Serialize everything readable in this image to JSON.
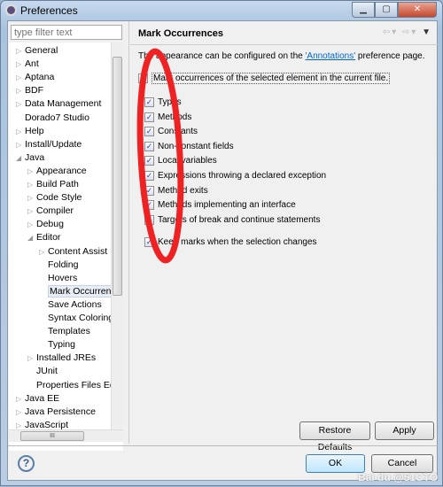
{
  "window": {
    "title": "Preferences",
    "controls": [
      "minimize",
      "maximize",
      "close"
    ]
  },
  "filter": {
    "placeholder": "type filter text"
  },
  "tree": [
    {
      "label": "General",
      "level": 0,
      "arrow": "collapsed"
    },
    {
      "label": "Ant",
      "level": 0,
      "arrow": "collapsed"
    },
    {
      "label": "Aptana",
      "level": 0,
      "arrow": "collapsed"
    },
    {
      "label": "BDF",
      "level": 0,
      "arrow": "collapsed"
    },
    {
      "label": "Data Management",
      "level": 0,
      "arrow": "collapsed"
    },
    {
      "label": "Dorado7 Studio",
      "level": 0,
      "arrow": "none"
    },
    {
      "label": "Help",
      "level": 0,
      "arrow": "collapsed"
    },
    {
      "label": "Install/Update",
      "level": 0,
      "arrow": "collapsed"
    },
    {
      "label": "Java",
      "level": 0,
      "arrow": "expanded"
    },
    {
      "label": "Appearance",
      "level": 1,
      "arrow": "collapsed"
    },
    {
      "label": "Build Path",
      "level": 1,
      "arrow": "collapsed"
    },
    {
      "label": "Code Style",
      "level": 1,
      "arrow": "collapsed"
    },
    {
      "label": "Compiler",
      "level": 1,
      "arrow": "collapsed"
    },
    {
      "label": "Debug",
      "level": 1,
      "arrow": "collapsed"
    },
    {
      "label": "Editor",
      "level": 1,
      "arrow": "expanded"
    },
    {
      "label": "Content Assist",
      "level": 2,
      "arrow": "collapsed"
    },
    {
      "label": "Folding",
      "level": 2,
      "arrow": "none"
    },
    {
      "label": "Hovers",
      "level": 2,
      "arrow": "none"
    },
    {
      "label": "Mark Occurren",
      "level": 2,
      "arrow": "none",
      "selected": true
    },
    {
      "label": "Save Actions",
      "level": 2,
      "arrow": "none"
    },
    {
      "label": "Syntax Coloring",
      "level": 2,
      "arrow": "none"
    },
    {
      "label": "Templates",
      "level": 2,
      "arrow": "none"
    },
    {
      "label": "Typing",
      "level": 2,
      "arrow": "none"
    },
    {
      "label": "Installed JREs",
      "level": 1,
      "arrow": "collapsed"
    },
    {
      "label": "JUnit",
      "level": 1,
      "arrow": "none"
    },
    {
      "label": "Properties Files Ed",
      "level": 1,
      "arrow": "none"
    },
    {
      "label": "Java EE",
      "level": 0,
      "arrow": "collapsed"
    },
    {
      "label": "Java Persistence",
      "level": 0,
      "arrow": "collapsed"
    },
    {
      "label": "JavaScript",
      "level": 0,
      "arrow": "collapsed"
    }
  ],
  "page": {
    "title": "Mark Occurrences",
    "desc_before": "The appearance can be configured on the ",
    "desc_link": "'Annotations'",
    "desc_after": " preference page.",
    "main_option": {
      "label": "Mark occurrences of the selected element in the current file.",
      "checked": true
    },
    "options": [
      {
        "label": "Types",
        "checked": true
      },
      {
        "label": "Methods",
        "checked": true
      },
      {
        "label": "Constants",
        "checked": true
      },
      {
        "label": "Non-constant fields",
        "checked": true
      },
      {
        "label": "Local variables",
        "checked": true
      },
      {
        "label": "Expressions throwing a declared exception",
        "checked": true
      },
      {
        "label": "Method exits",
        "checked": true
      },
      {
        "label": "Methods implementing an interface",
        "checked": true
      },
      {
        "label": "Targets of break and continue statements",
        "checked": true
      }
    ],
    "keep_option": {
      "label": "Keep marks when the selection changes",
      "checked": true
    },
    "restore_defaults": "Restore Defaults",
    "apply": "Apply"
  },
  "footer": {
    "ok": "OK",
    "cancel": "Cancel"
  },
  "annotation_color": "#ee2222",
  "watermark": "Bai du 经验 @51CTO博客"
}
